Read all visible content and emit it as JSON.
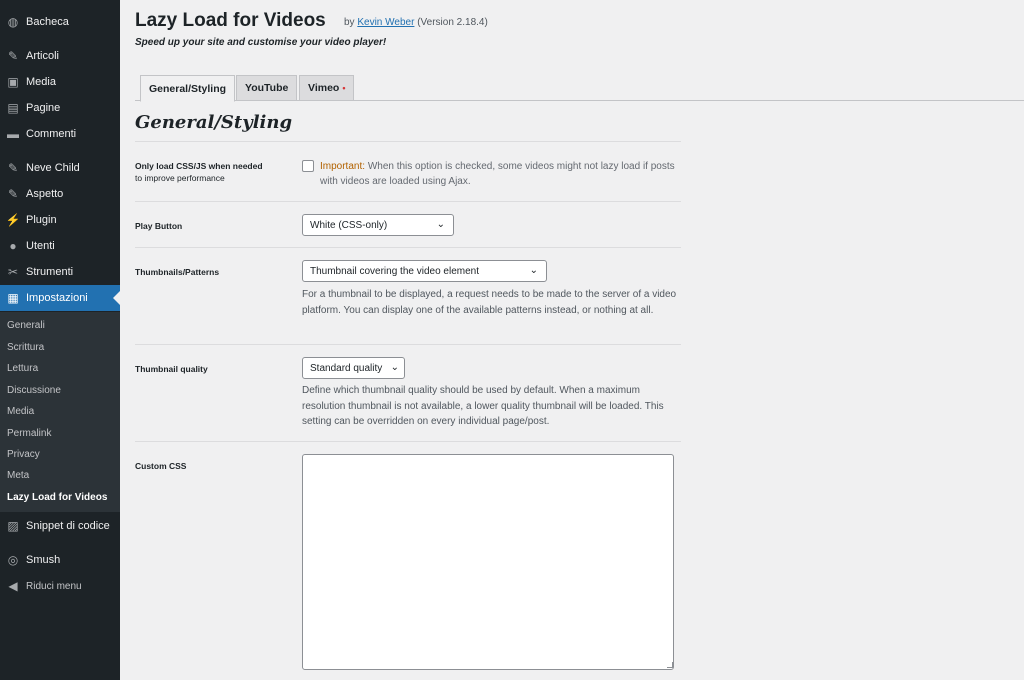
{
  "sidebar": {
    "items": [
      {
        "label": "Bacheca",
        "icon": "dashboard-icon",
        "glyph": "◍"
      },
      {
        "label": "Articoli",
        "icon": "pin-icon",
        "glyph": "✎"
      },
      {
        "label": "Media",
        "icon": "media-icon",
        "glyph": "▣"
      },
      {
        "label": "Pagine",
        "icon": "pages-icon",
        "glyph": "▤"
      },
      {
        "label": "Commenti",
        "icon": "comments-icon",
        "glyph": "▬"
      },
      {
        "label": "Neve Child",
        "icon": "appearance-icon",
        "glyph": "✎"
      },
      {
        "label": "Aspetto",
        "icon": "brush-icon",
        "glyph": "✎"
      },
      {
        "label": "Plugin",
        "icon": "plugin-icon",
        "glyph": "⚡"
      },
      {
        "label": "Utenti",
        "icon": "users-icon",
        "glyph": "●"
      },
      {
        "label": "Strumenti",
        "icon": "tools-icon",
        "glyph": "✂"
      },
      {
        "label": "Impostazioni",
        "icon": "settings-icon",
        "glyph": "▦"
      },
      {
        "label": "Snippet di codice",
        "icon": "code-snippets-icon",
        "glyph": "▨"
      },
      {
        "label": "Smush",
        "icon": "smush-icon",
        "glyph": "◎"
      },
      {
        "label": "Riduci menu",
        "icon": "collapse-menu-icon",
        "glyph": "◀"
      }
    ],
    "submenu": [
      "Generali",
      "Scrittura",
      "Lettura",
      "Discussione",
      "Media",
      "Permalink",
      "Privacy",
      "Meta",
      "Lazy Load for Videos"
    ]
  },
  "header": {
    "title": "Lazy Load for Videos",
    "by": "by",
    "author": "Kevin Weber",
    "version": "(Version 2.18.4)",
    "tagline": "Speed up your site and customise your video player!"
  },
  "tabs": [
    {
      "label": "General/Styling"
    },
    {
      "label": "YouTube"
    },
    {
      "label": "Vimeo"
    }
  ],
  "section_title": "General/Styling",
  "fields": {
    "only_load": {
      "label": "Only load CSS/JS when needed",
      "sublabel": "to improve performance",
      "important_prefix": "Important:",
      "important_text": "When this option is checked, some videos might not lazy load if posts with videos are loaded using Ajax.",
      "checked": false
    },
    "play_button": {
      "label": "Play Button",
      "value": "White (CSS-only)"
    },
    "thumbnails": {
      "label": "Thumbnails/Patterns",
      "value": "Thumbnail covering the video element",
      "description": "For a thumbnail to be displayed, a request needs to be made to the server of a video platform. You can display one of the available patterns instead, or nothing at all."
    },
    "thumb_quality": {
      "label": "Thumbnail quality",
      "value": "Standard quality",
      "description": "Define which thumbnail quality should be used by default. When a maximum resolution thumbnail is not available, a lower quality thumbnail will be loaded. This setting can be overridden on every individual page/post."
    },
    "custom_css": {
      "label": "Custom CSS",
      "value": ""
    }
  }
}
